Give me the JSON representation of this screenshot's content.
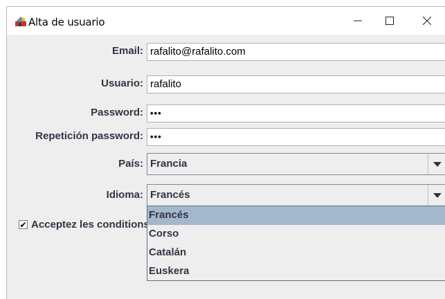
{
  "window": {
    "title": "Alta de usuario",
    "minimize_glyph": "—",
    "maximize_glyph": "☐",
    "close_glyph": "✕"
  },
  "form": {
    "email": {
      "label": "Email:",
      "value": "rafalito@rafalito.com"
    },
    "usuario": {
      "label": "Usuario:",
      "value": "rafalito"
    },
    "password": {
      "label": "Password:",
      "value": "•••"
    },
    "repeat_password": {
      "label": "Repetición password:",
      "value": "•••"
    },
    "pais": {
      "label": "País:",
      "selected": "Francia"
    },
    "idioma": {
      "label": "Idioma:",
      "selected": "Francés",
      "options": [
        "Francés",
        "Corso",
        "Catalán",
        "Euskera"
      ]
    },
    "accept_conditions": {
      "label": "Acceptez les conditions",
      "checked": true,
      "check_glyph": "✔"
    }
  },
  "icons": [
    "app-icon",
    "minimize-icon",
    "maximize-icon",
    "close-icon",
    "chevron-down-icon"
  ]
}
